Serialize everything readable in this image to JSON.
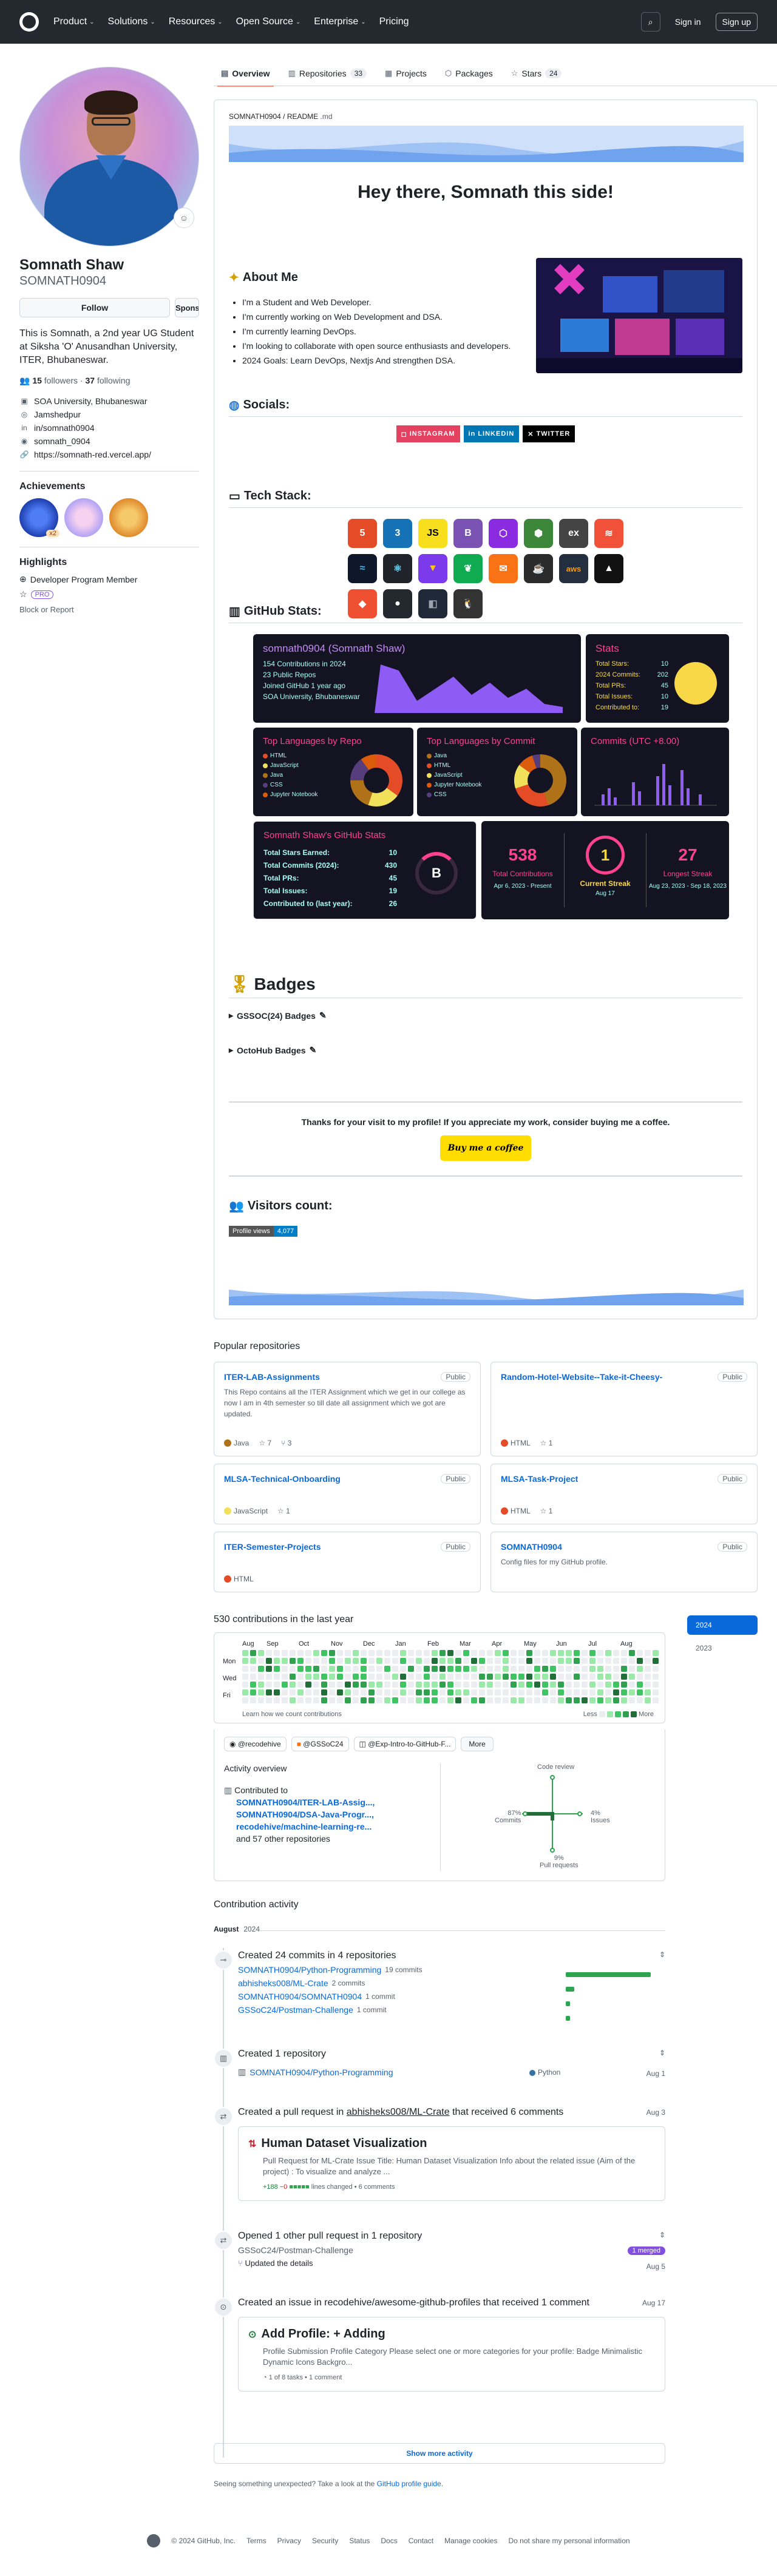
{
  "header": {
    "nav": [
      "Product",
      "Solutions",
      "Resources",
      "Open Source",
      "Enterprise",
      "Pricing"
    ],
    "signin": "Sign in",
    "signup": "Sign up"
  },
  "tabs": [
    {
      "label": "Overview",
      "icon": "book-icon"
    },
    {
      "label": "Repositories",
      "count": "33",
      "icon": "repo-icon"
    },
    {
      "label": "Projects",
      "icon": "table-icon"
    },
    {
      "label": "Packages",
      "icon": "package-icon"
    },
    {
      "label": "Stars",
      "count": "24",
      "icon": "star-icon"
    }
  ],
  "profile": {
    "name": "Somnath Shaw",
    "username": "SOMNATH0904",
    "follow": "Follow",
    "sponsor": "Sponsor",
    "bio": "This is Somnath, a 2nd year UG Student at Siksha 'O' Anusandhan University, ITER, Bhubaneswar.",
    "followers": "15",
    "followers_label": "followers",
    "following": "37",
    "following_label": "following",
    "org": "SOA University, Bhubaneswar",
    "location": "Jamshedpur",
    "linkedin": "in/somnath0904",
    "social": "somnath_0904",
    "website": "https://somnath-red.vercel.app/"
  },
  "achievements": {
    "title": "Achievements",
    "count": "x2"
  },
  "highlights": {
    "title": "Highlights",
    "member": "Developer Program Member",
    "pro": "PRO"
  },
  "block": "Block or Report",
  "readme": {
    "path_user": "SOMNATH0904",
    "path_file": "README",
    "path_ext": ".md",
    "title": "Hey there, Somnath this side!",
    "about_title": "About Me",
    "about": [
      "I'm a Student and Web Developer.",
      "I'm currently working on Web Development and DSA.",
      "I'm currently learning DevOps.",
      "I'm looking to collaborate with open source enthusiasts and developers.",
      "2024 Goals: Learn DevOps, Nextjs And strengthen DSA."
    ],
    "socials_title": "Socials:",
    "socials": [
      "INSTAGRAM",
      "LINKEDIN",
      "TWITTER"
    ],
    "stack_title": "Tech Stack:",
    "stats_title": "GitHub Stats:",
    "badges_title": "Badges",
    "badge1": "GSSOC(24) Badges",
    "badge2": "OctoHub Badges",
    "thanks": "Thanks for your visit to my profile! If you appreciate my work, consider buying me a coffee.",
    "coffee": "Buy me a coffee",
    "visitors_title": "Visitors count:",
    "views_label": "Profile views",
    "views": "4,077"
  },
  "cards": {
    "activity_title": "somnath0904 (Somnath Shaw)",
    "activity_lines": [
      "154 Contributions in 2024",
      "23 Public Repos",
      "Joined GitHub 1 year ago",
      "SOA University, Bhubaneswar"
    ],
    "stats_title": "Stats",
    "stats": [
      [
        "Total Stars:",
        "10"
      ],
      [
        "2024 Commits:",
        "202"
      ],
      [
        "Total PRs:",
        "45"
      ],
      [
        "Total Issues:",
        "10"
      ],
      [
        "Contributed to:",
        "19"
      ]
    ],
    "top_repo": "Top Languages by Repo",
    "top_repo_langs": [
      "HTML",
      "JavaScript",
      "Java",
      "CSS",
      "Jupyter Notebook"
    ],
    "top_commit": "Top Languages by Commit",
    "top_commit_langs": [
      "Java",
      "HTML",
      "JavaScript",
      "Jupyter Notebook",
      "CSS"
    ],
    "commits_title": "Commits (UTC +8.00)",
    "gh_stats_title": "Somnath Shaw's GitHub Stats",
    "gh_stats": [
      [
        "Total Stars Earned:",
        "10"
      ],
      [
        "Total Commits (2024):",
        "430"
      ],
      [
        "Total PRs:",
        "45"
      ],
      [
        "Total Issues:",
        "19"
      ],
      [
        "Contributed to (last year):",
        "26"
      ]
    ],
    "grade": "B",
    "streak": {
      "total": "538",
      "total_label": "Total Contributions",
      "total_range": "Apr 6, 2023 - Present",
      "current": "1",
      "current_label": "Current Streak",
      "current_range": "Aug 17",
      "longest": "27",
      "longest_label": "Longest Streak",
      "longest_range": "Aug 23, 2023 - Sep 18, 2023"
    }
  },
  "popular": {
    "title": "Popular repositories",
    "public": "Public",
    "repos": [
      {
        "name": "ITER-LAB-Assignments",
        "desc": "This Repo contains all the ITER Assignment which we get in our college as now I am in 4th semester so till date all assignment which we got are updated.",
        "lang": "Java",
        "color": "#b07219",
        "stars": "7",
        "forks": "3"
      },
      {
        "name": "Random-Hotel-Website--Take-it-Cheesy-",
        "desc": "",
        "lang": "HTML",
        "color": "#e34c26",
        "stars": "1",
        "forks": ""
      },
      {
        "name": "MLSA-Technical-Onboarding",
        "desc": "",
        "lang": "JavaScript",
        "color": "#f1e05a",
        "stars": "1",
        "forks": ""
      },
      {
        "name": "MLSA-Task-Project",
        "desc": "",
        "lang": "HTML",
        "color": "#e34c26",
        "stars": "1",
        "forks": ""
      },
      {
        "name": "ITER-Semester-Projects",
        "desc": "",
        "lang": "HTML",
        "color": "#e34c26",
        "stars": "",
        "forks": ""
      },
      {
        "name": "SOMNATH0904",
        "desc": "Config files for my GitHub profile.",
        "lang": "",
        "color": "",
        "stars": "",
        "forks": ""
      }
    ]
  },
  "contributions": {
    "title": "530 contributions in the last year",
    "months": [
      "Aug",
      "Sep",
      "Oct",
      "Nov",
      "Dec",
      "Jan",
      "Feb",
      "Mar",
      "Apr",
      "May",
      "Jun",
      "Jul",
      "Aug"
    ],
    "days": [
      "Mon",
      "Wed",
      "Fri"
    ],
    "learn": "Learn how we count contributions",
    "less": "Less",
    "more": "More",
    "years": [
      "2024",
      "2023"
    ],
    "orgs": [
      "@recodehive",
      "@GSSoC24",
      "@Exp-Intro-to-GitHub-F..."
    ],
    "more_btn": "More",
    "overview": "Activity overview",
    "contributed_to": "Contributed to",
    "contrib_repos": [
      "SOMNATH0904/ITER-LAB-Assig...,",
      "SOMNATH0904/DSA-Java-Progr...,",
      "recodehive/machine-learning-re..."
    ],
    "others": "and 57 other repositories",
    "radar": {
      "code_review": "Code review",
      "commits": "Commits",
      "commits_pct": "87%",
      "issues": "Issues",
      "issues_pct": "4%",
      "prs": "Pull requests",
      "prs_pct": "9%"
    }
  },
  "activity": {
    "title": "Contribution activity",
    "month": "August",
    "year": "2024",
    "commits_h": "Created 24 commits in 4 repositories",
    "commit_repos": [
      {
        "repo": "SOMNATH0904/Python-Programming",
        "n": "19 commits"
      },
      {
        "repo": "abhisheks008/ML-Crate",
        "n": "2 commits"
      },
      {
        "repo": "SOMNATH0904/SOMNATH0904",
        "n": "1 commit"
      },
      {
        "repo": "GSSoC24/Postman-Challenge",
        "n": "1 commit"
      }
    ],
    "created_repo_h": "Created 1 repository",
    "created_repo": "SOMNATH0904/Python-Programming",
    "created_repo_lang": "Python",
    "created_repo_date": "Aug 1",
    "pr_h_pre": "Created a pull request in",
    "pr_h_repo": "abhisheks008/ML-Crate",
    "pr_h_post": "that received 6 comments",
    "pr_date": "Aug 3",
    "pr_title": "Human Dataset Visualization",
    "pr_body": "Pull Request for ML-Crate Issue Title: Human Dataset Visualization Info about the related issue (Aim of the project) : To visualize and analyze ...",
    "pr_add": "+188",
    "pr_del": "−0",
    "pr_changed": "lines changed",
    "pr_comments": "6 comments",
    "opened_h": "Opened 1 other pull request in 1 repository",
    "opened_repo": "GSSoC24/Postman-Challenge",
    "opened_badge": "1 merged",
    "opened_item": "Updated the details",
    "opened_date": "Aug 5",
    "issue_h": "Created an issue in recodehive/awesome-github-profiles that received 1 comment",
    "issue_date": "Aug 17",
    "issue_title": "Add Profile: + Adding",
    "issue_body": "Profile Submission Profile Category Please select one or more categories for your profile: Badge Minimalistic Dynamic Icons Backgro...",
    "issue_meta": "1 of 8 tasks",
    "issue_comments": "1 comment",
    "show_more": "Show more activity",
    "unexpected": "Seeing something unexpected? Take a look at the",
    "guide": "GitHub profile guide"
  },
  "footer": [
    "© 2024 GitHub, Inc.",
    "Terms",
    "Privacy",
    "Security",
    "Status",
    "Docs",
    "Contact",
    "Manage cookies",
    "Do not share my personal information"
  ]
}
